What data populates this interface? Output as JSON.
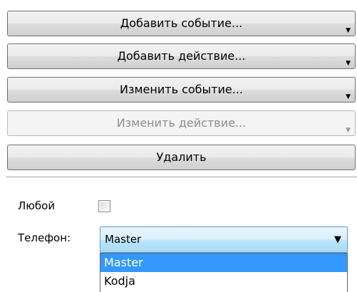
{
  "buttons": {
    "add_event": "Добавить событие...",
    "add_action": "Добавить действие...",
    "edit_event": "Изменить событие...",
    "edit_action": "Изменить действие...",
    "delete": "Удалить"
  },
  "form": {
    "any_label": "Любой",
    "any_checked": false,
    "phone_label": "Телефон:",
    "phone_value": "Master",
    "phone_options": [
      "Master",
      "Kodja"
    ]
  }
}
